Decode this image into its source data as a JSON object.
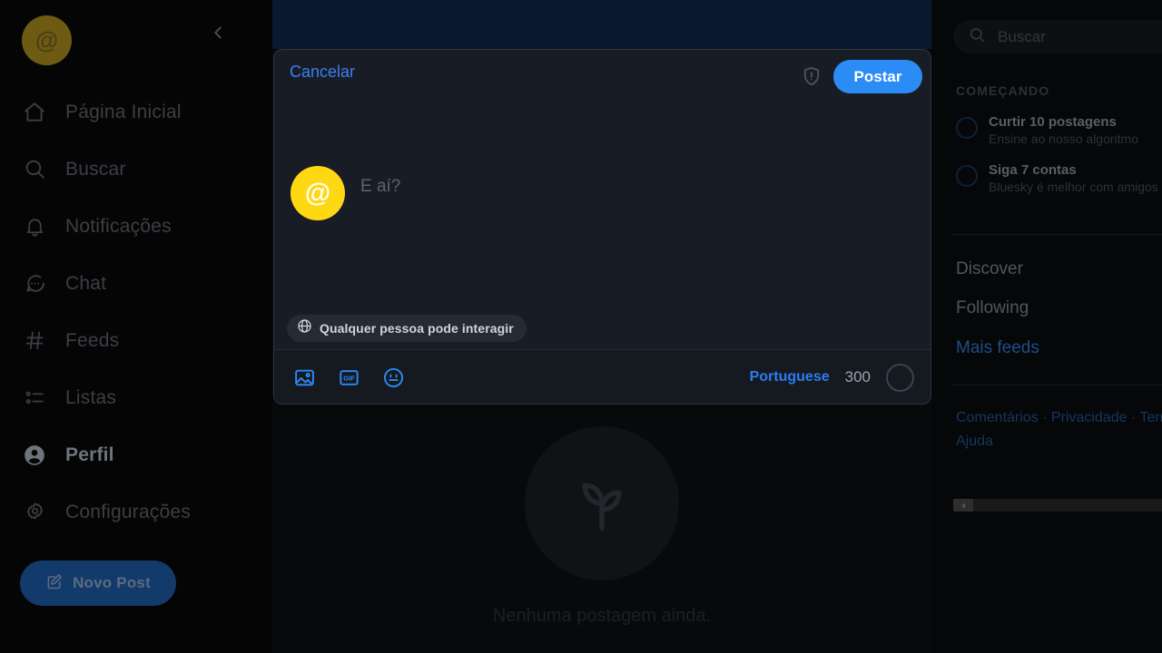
{
  "left_sidebar": {
    "avatar_glyph": "@",
    "collapse_icon": "chevron-left-icon",
    "nav_items": [
      {
        "label": "Página Inicial",
        "icon": "home-icon",
        "active": false
      },
      {
        "label": "Buscar",
        "icon": "search-icon",
        "active": false
      },
      {
        "label": "Notificações",
        "icon": "bell-icon",
        "active": false
      },
      {
        "label": "Chat",
        "icon": "chat-bubble-icon",
        "active": false
      },
      {
        "label": "Feeds",
        "icon": "hashtag-icon",
        "active": false
      },
      {
        "label": "Listas",
        "icon": "list-icon",
        "active": false
      },
      {
        "label": "Perfil",
        "icon": "user-circle-icon",
        "active": true
      },
      {
        "label": "Configurações",
        "icon": "gear-icon",
        "active": false
      }
    ],
    "new_post_button": {
      "label": "Novo Post",
      "icon": "compose-icon"
    }
  },
  "center": {
    "empty_state_text": "Nenhuma postagem ainda.",
    "empty_state_icon": "sprout-icon"
  },
  "composer": {
    "cancel_label": "Cancelar",
    "post_label": "Postar",
    "shield_icon": "shield-alert-icon",
    "avatar_glyph": "@",
    "text_value": "",
    "placeholder": "E aí?",
    "interaction_pill": {
      "label": "Qualquer pessoa pode interagir",
      "icon": "globe-icon"
    },
    "footer_icons": [
      {
        "name": "image-icon",
        "label": ""
      },
      {
        "name": "gif-icon",
        "label": "GIF"
      },
      {
        "name": "emoji-icon",
        "label": ""
      }
    ],
    "language_label": "Portuguese",
    "char_count": "300",
    "accent_color": "#2b8cf5"
  },
  "right_sidebar": {
    "search_placeholder": "Buscar",
    "search_icon": "search-icon",
    "section_title": "COMEÇANDO",
    "tasks": [
      {
        "title": "Curtir 10 postagens",
        "subtitle": "Ensine ao nosso algoritmo"
      },
      {
        "title": "Siga 7 contas",
        "subtitle": "Bluesky é melhor com amigos"
      }
    ],
    "feeds": [
      {
        "label": "Discover",
        "muted": false
      },
      {
        "label": "Following",
        "muted": false
      },
      {
        "label": "Mais feeds",
        "muted": true
      }
    ],
    "footer_text": "Comentários · Privacidade · Termos · Ajuda",
    "scrollbar_icon": "scroll-left-icon"
  }
}
